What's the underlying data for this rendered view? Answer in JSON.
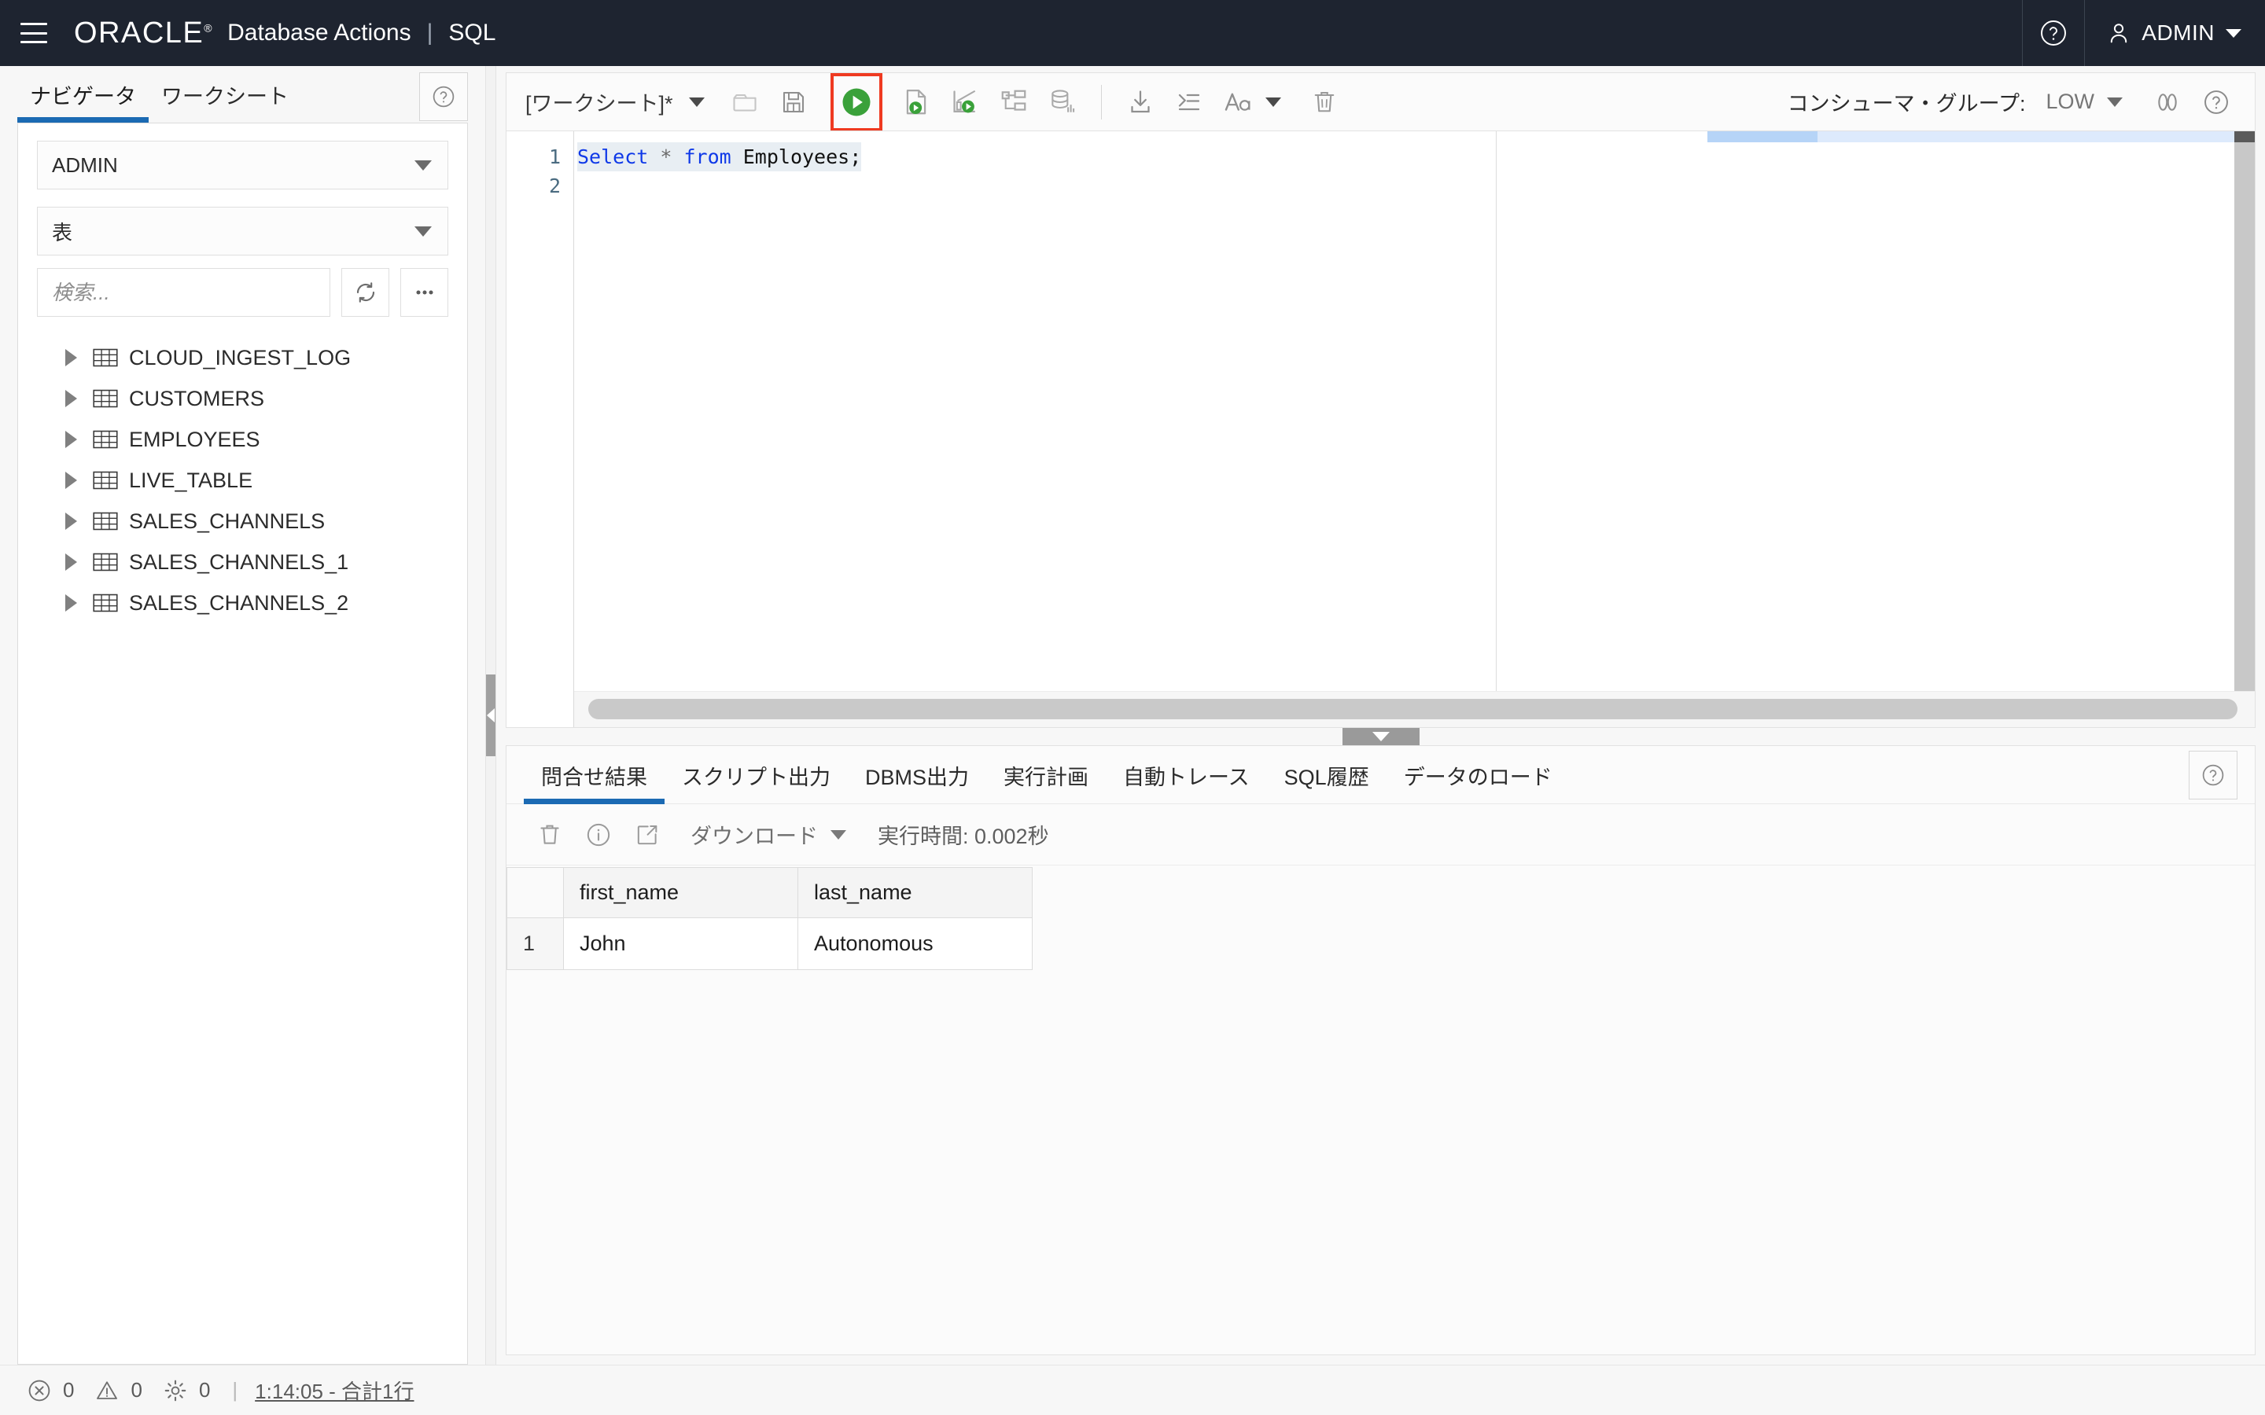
{
  "header": {
    "menu_icon": "hamburger-icon",
    "brand": "ORACLE",
    "brand_mark": "®",
    "product": "Database Actions",
    "separator": "|",
    "module": "SQL",
    "help_icon": "help-circle-icon",
    "user_icon": "user-icon",
    "user_name": "ADMIN",
    "user_caret": "chevron-down-icon"
  },
  "left_panel": {
    "tabs": [
      {
        "label": "ナビゲータ",
        "active": true
      },
      {
        "label": "ワークシート",
        "active": false
      }
    ],
    "help_icon": "help-circle-icon",
    "schema_select": {
      "value": "ADMIN",
      "caret": "caret-down-icon"
    },
    "object_type_select": {
      "value": "表",
      "caret": "caret-down-icon"
    },
    "search": {
      "value": "",
      "placeholder": "検索..."
    },
    "refresh_icon": "refresh-icon",
    "more_icon": "more-options-icon",
    "tree_items": [
      {
        "label": "CLOUD_INGEST_LOG",
        "icon": "table-icon"
      },
      {
        "label": "CUSTOMERS",
        "icon": "table-icon"
      },
      {
        "label": "EMPLOYEES",
        "icon": "table-icon"
      },
      {
        "label": "LIVE_TABLE",
        "icon": "table-icon"
      },
      {
        "label": "SALES_CHANNELS",
        "icon": "table-icon"
      },
      {
        "label": "SALES_CHANNELS_1",
        "icon": "table-icon"
      },
      {
        "label": "SALES_CHANNELS_2",
        "icon": "table-icon"
      }
    ],
    "collapse_handle_icon": "chevron-left-icon"
  },
  "worksheet": {
    "tab_name": "[ワークシート]*",
    "tab_caret": "caret-down-icon",
    "toolbar_icons": [
      {
        "name": "open-file-icon"
      },
      {
        "name": "save-icon"
      },
      {
        "name": "run-statement-icon",
        "highlighted": true
      },
      {
        "name": "run-script-icon"
      },
      {
        "name": "explain-plan-icon"
      },
      {
        "name": "autotrace-icon"
      },
      {
        "name": "sql-tuning-advisor-icon"
      },
      {
        "name": "download-icon"
      },
      {
        "name": "format-sql-icon"
      },
      {
        "name": "font-size-icon"
      },
      {
        "name": "clear-worksheet-icon"
      }
    ],
    "consumer_group_label": "コンシューマ・グループ:",
    "consumer_group_value": "LOW",
    "consumer_group_caret": "caret-down-icon",
    "find_icon": "find-icon",
    "help_icon": "help-circle-icon",
    "highlight_color": "#ef3a21",
    "run_button_color": "#3aa13a"
  },
  "editor": {
    "line_numbers": [
      "1",
      "2"
    ],
    "code_tokens": [
      {
        "text": "Select",
        "type": "keyword"
      },
      {
        "text": " * ",
        "type": "operator"
      },
      {
        "text": "from",
        "type": "keyword"
      },
      {
        "text": " Employees;",
        "type": "identifier"
      }
    ],
    "code_plain": "Select * from Employees;",
    "keyword_color": "#0f39e8",
    "selection_color": "#e8eef3"
  },
  "results": {
    "tabs": [
      {
        "label": "問合せ結果",
        "active": true
      },
      {
        "label": "スクリプト出力",
        "active": false
      },
      {
        "label": "DBMS出力",
        "active": false
      },
      {
        "label": "実行計画",
        "active": false
      },
      {
        "label": "自動トレース",
        "active": false
      },
      {
        "label": "SQL履歴",
        "active": false
      },
      {
        "label": "データのロード",
        "active": false
      }
    ],
    "help_icon": "help-circle-icon",
    "toolbar": {
      "clear_icon": "trash-icon",
      "info_icon": "info-icon",
      "open-in-new_icon": "open-external-icon",
      "download_label": "ダウンロード",
      "download_caret": "caret-down-icon",
      "exec_time": "実行時間: 0.002秒"
    },
    "grid": {
      "columns": [
        "",
        "first_name",
        "last_name"
      ],
      "rows": [
        {
          "num": "1",
          "first_name": "John",
          "last_name": "Autonomous"
        }
      ]
    },
    "splitter_icon": "chevron-down-icon"
  },
  "statusbar": {
    "error_icon": "error-circle-icon",
    "error_count": "0",
    "warning_icon": "warning-triangle-icon",
    "warning_count": "0",
    "settings_icon": "gear-icon",
    "settings_count": "0",
    "divider": "|",
    "status_text": "1:14:05 - 合計1行"
  }
}
